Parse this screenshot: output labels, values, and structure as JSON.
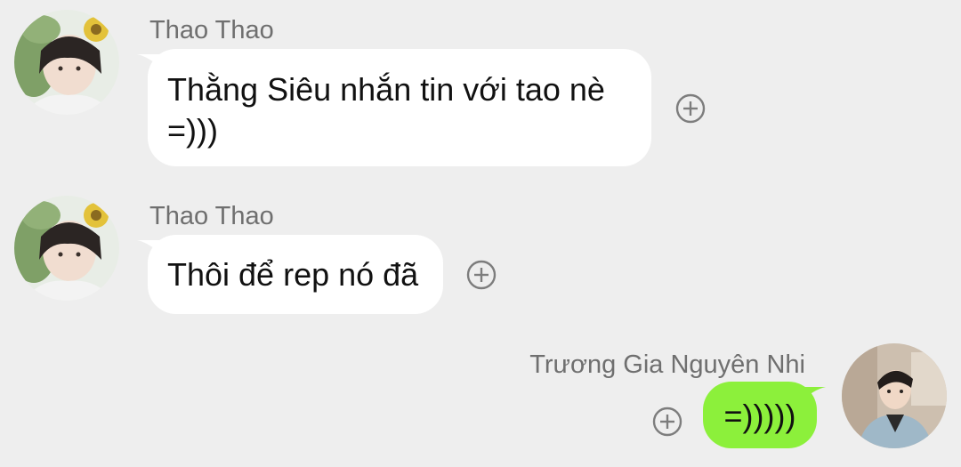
{
  "messages": [
    {
      "sender": "Thao Thao",
      "text_lines": [
        "Thằng Siêu nhắn tin với tao nè",
        "=)))"
      ],
      "direction": "incoming",
      "avatar": "thao-thao-avatar-photo",
      "reaction_icon": "add-reaction-icon"
    },
    {
      "sender": "Thao Thao",
      "text_lines": [
        "Thôi để rep nó đã"
      ],
      "direction": "incoming",
      "avatar": "thao-thao-avatar-photo",
      "reaction_icon": "add-reaction-icon"
    },
    {
      "sender": "Trương Gia Nguyên Nhi",
      "text_lines": [
        "=)))))"
      ],
      "direction": "outgoing",
      "avatar": "truong-gia-nguyen-nhi-avatar-photo",
      "reaction_icon": "add-reaction-icon"
    }
  ],
  "colors": {
    "background": "#eeeeee",
    "incoming_bubble": "#ffffff",
    "outgoing_bubble": "#8cf03b",
    "sender_name": "#6f6f6f",
    "message_text": "#111111",
    "icon_stroke": "#7d7d7d"
  }
}
